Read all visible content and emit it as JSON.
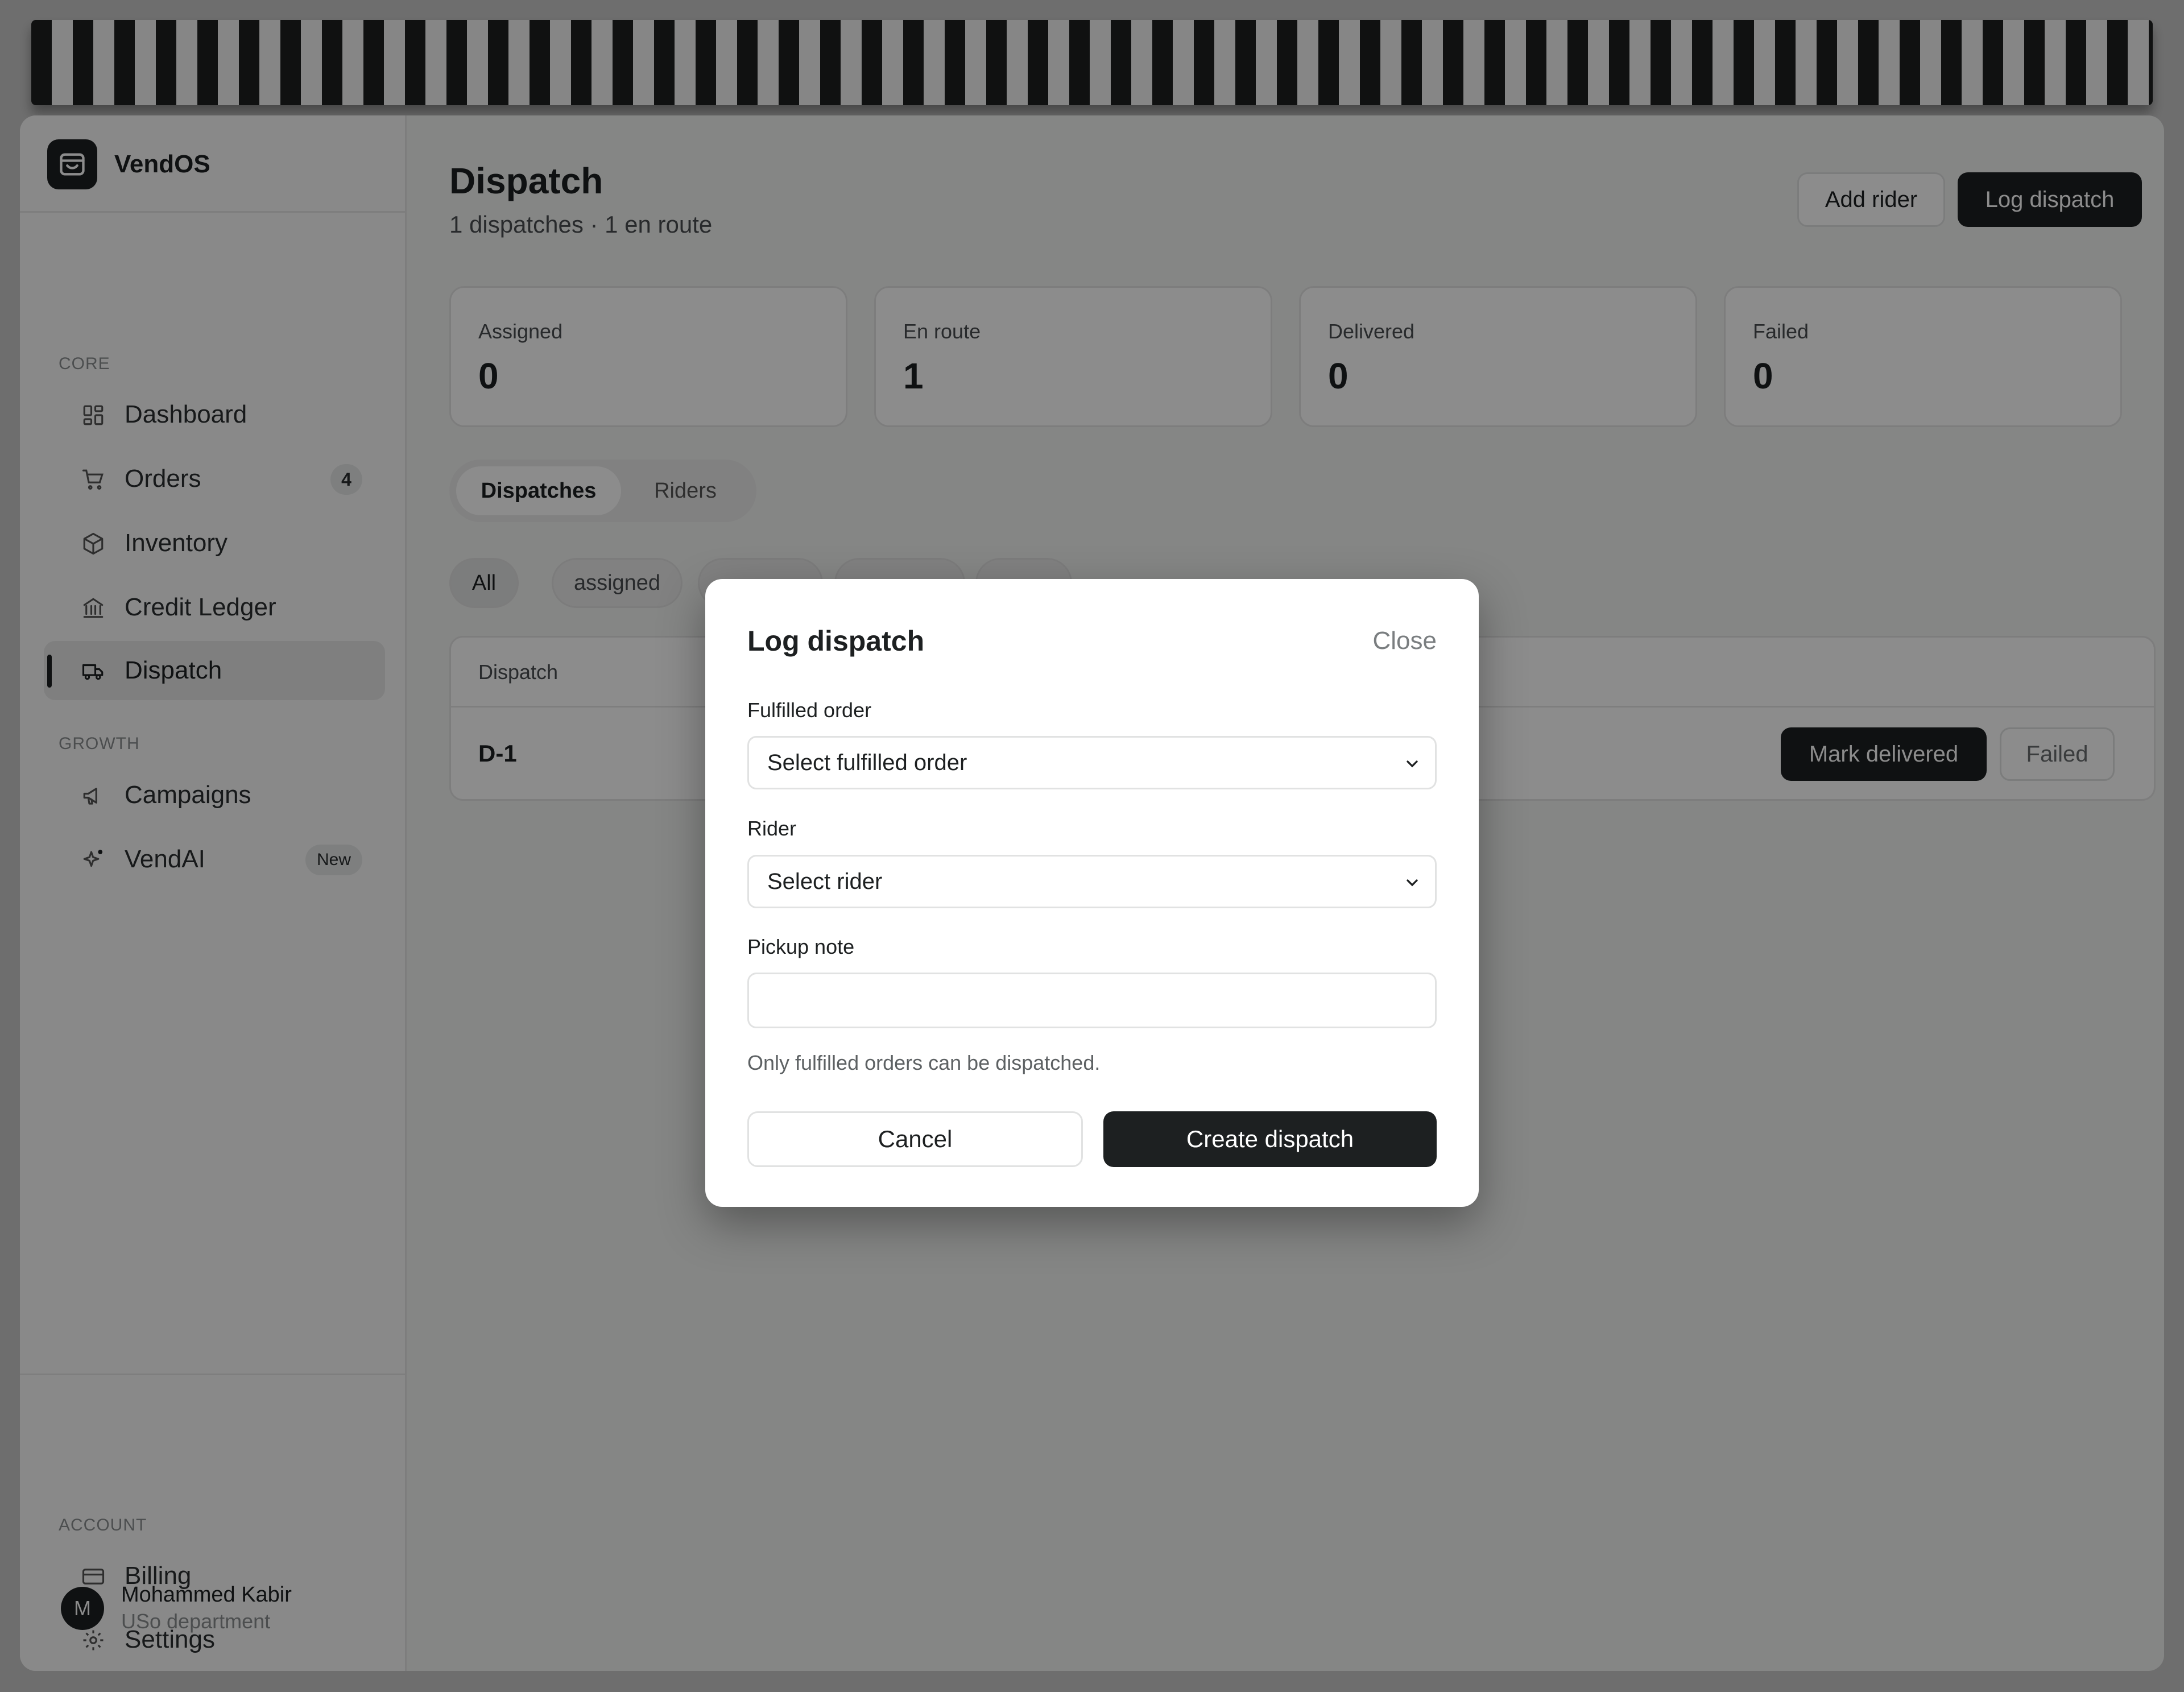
{
  "app": {
    "name": "VendOS"
  },
  "sidebar": {
    "sections": {
      "core": "CORE",
      "growth": "GROWTH",
      "account": "ACCOUNT"
    },
    "items": [
      {
        "label": "Dashboard"
      },
      {
        "label": "Orders",
        "badge": "4"
      },
      {
        "label": "Inventory"
      },
      {
        "label": "Credit Ledger"
      },
      {
        "label": "Dispatch"
      },
      {
        "label": "Campaigns"
      },
      {
        "label": "VendAI",
        "badge": "New"
      },
      {
        "label": "Billing"
      },
      {
        "label": "Settings"
      }
    ],
    "user": {
      "initial": "M",
      "name": "Mohammed Kabir",
      "department": "USo department"
    }
  },
  "page": {
    "title": "Dispatch",
    "subtitle": "1 dispatches · 1 en route",
    "add_rider_label": "Add rider",
    "log_dispatch_label": "Log dispatch"
  },
  "stats": [
    {
      "label": "Assigned",
      "value": "0"
    },
    {
      "label": "En route",
      "value": "1"
    },
    {
      "label": "Delivered",
      "value": "0"
    },
    {
      "label": "Failed",
      "value": "0"
    }
  ],
  "tabs": [
    {
      "label": "Dispatches"
    },
    {
      "label": "Riders"
    }
  ],
  "filters": [
    {
      "label": "All"
    },
    {
      "label": "assigned"
    }
  ],
  "table": {
    "columns": [
      "Dispatch"
    ],
    "rows": [
      {
        "id": "D-1",
        "mark_delivered": "Mark delivered",
        "failed": "Failed"
      }
    ]
  },
  "modal": {
    "title": "Log dispatch",
    "close_label": "Close",
    "fulfilled_label": "Fulfilled order",
    "fulfilled_value": "Select fulfilled order",
    "rider_label": "Rider",
    "rider_value": "Select rider",
    "note_label": "Pickup note",
    "note_value": "",
    "hint": "Only fulfilled orders can be dispatched.",
    "cancel_label": "Cancel",
    "create_label": "Create dispatch"
  },
  "colors": {
    "accent": "#1d2021",
    "background": "#f3f4f3",
    "overlay": "rgba(0,0,0,0.45)"
  }
}
